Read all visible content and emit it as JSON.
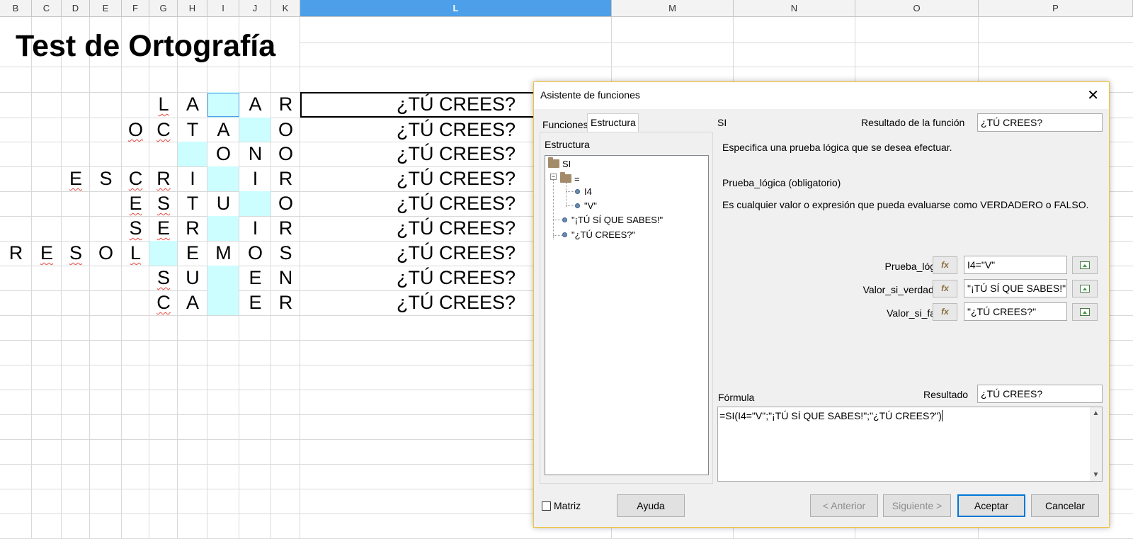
{
  "sheet": {
    "column_headers": [
      "B",
      "C",
      "D",
      "E",
      "F",
      "G",
      "H",
      "I",
      "J",
      "K",
      "L",
      "M",
      "N",
      "O",
      "P"
    ],
    "selected_column": "L",
    "title": "Test de Ortografía",
    "rows": [
      {
        "letters": {
          "G": "L",
          "H": "A",
          "J": "A",
          "K": "R"
        },
        "blanks": [
          "I"
        ],
        "result": "¿TÚ CREES?"
      },
      {
        "letters": {
          "F": "O",
          "G": "C",
          "H": "T",
          "I": "A",
          "K": "O"
        },
        "blanks": [
          "J"
        ],
        "result": "¿TÚ CREES?"
      },
      {
        "letters": {
          "I": "O",
          "J": "N",
          "K": "O"
        },
        "blanks": [
          "H"
        ],
        "result": "¿TÚ CREES?"
      },
      {
        "letters": {
          "D": "E",
          "E": "S",
          "F": "C",
          "G": "R",
          "H": "I",
          "J": "I",
          "K": "R"
        },
        "blanks": [
          "I"
        ],
        "result": "¿TÚ CREES?"
      },
      {
        "letters": {
          "F": "E",
          "G": "S",
          "H": "T",
          "I": "U",
          "K": "O"
        },
        "blanks": [
          "J"
        ],
        "result": "¿TÚ CREES?"
      },
      {
        "letters": {
          "F": "S",
          "G": "E",
          "H": "R",
          "J": "I",
          "K": "R"
        },
        "blanks": [
          "I"
        ],
        "result": "¿TÚ CREES?"
      },
      {
        "letters": {
          "B": "R",
          "C": "E",
          "D": "S",
          "E": "O",
          "F": "L",
          "H": "E",
          "I": "M",
          "J": "O",
          "K": "S"
        },
        "blanks": [
          "G"
        ],
        "result": "¿TÚ CREES?"
      },
      {
        "letters": {
          "G": "S",
          "H": "U",
          "J": "E",
          "K": "N"
        },
        "blanks": [
          "I"
        ],
        "result": "¿TÚ CREES?"
      },
      {
        "letters": {
          "G": "C",
          "H": "A",
          "J": "E",
          "K": "R"
        },
        "blanks": [
          "I"
        ],
        "result": "¿TÚ CREES?"
      }
    ]
  },
  "dialog": {
    "title": "Asistente de funciones",
    "close_glyph": "✕",
    "tabs": [
      {
        "label": "Funciones"
      },
      {
        "label": "Estructura"
      }
    ],
    "structure_label": "Estructura",
    "tree": {
      "root": "SI",
      "eq": "=",
      "eq_children": [
        "I4",
        "\"V\""
      ],
      "true_val": "\"¡TÚ SÍ QUE SABES!\"",
      "false_val": "\"¿TÚ CREES?\""
    },
    "function_name": "SI",
    "function_result_label": "Resultado de la función",
    "function_result_value": "¿TÚ CREES?",
    "description": "Especifica una prueba lógica que se desea efectuar.",
    "param_heading": "Prueba_lógica (obligatorio)",
    "param_description": "Es cualquier valor o expresión que pueda evaluarse como VERDADERO o FALSO.",
    "params": [
      {
        "label": "Prueba_lógica",
        "value": "I4=\"V\""
      },
      {
        "label": "Valor_si_verdadero",
        "value": "\"¡TÚ SÍ QUE SABES!\""
      },
      {
        "label": "Valor_si_falso",
        "value": "\"¿TÚ CREES?\""
      }
    ],
    "fx_glyph": "fx",
    "formula_label": "Fórmula",
    "result_label": "Resultado",
    "result_value": "¿TÚ CREES?",
    "formula": "=SI(I4=\"V\";\"¡TÚ SÍ QUE SABES!\";\"¿TÚ CREES?\")",
    "scroll_up": "▲",
    "scroll_down": "▼",
    "matriz_label": "Matriz",
    "buttons": {
      "ayuda": "Ayuda",
      "anterior": "< Anterior",
      "siguiente": "Siguiente >",
      "aceptar": "Aceptar",
      "cancelar": "Cancelar"
    }
  }
}
